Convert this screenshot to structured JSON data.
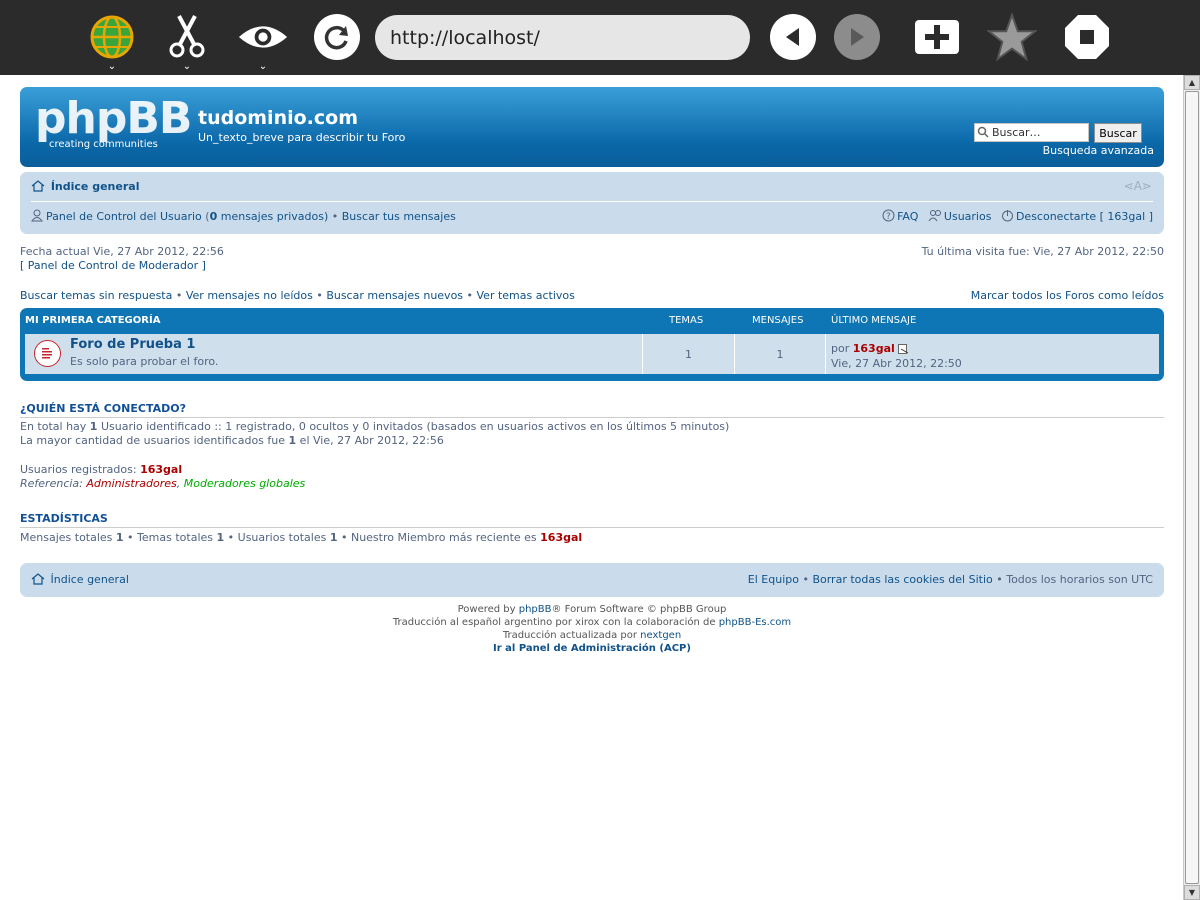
{
  "browser": {
    "url": "http://localhost/",
    "icons": [
      "globe-icon",
      "scissors-icon",
      "eye-icon",
      "reload-icon",
      "back-icon",
      "forward-icon",
      "add-bookmark-icon",
      "star-icon",
      "stop-icon"
    ],
    "caret": "⌄"
  },
  "header": {
    "logo_main": "phpBB",
    "logo_reg": "®",
    "logo_sub": "creating communities",
    "site_title": "tudominio.com",
    "site_desc": "Un_texto_breve para describir tu Foro",
    "search_placeholder": "Buscar…",
    "search_button": "Buscar",
    "advanced_search": "Busqueda avanzada"
  },
  "navbar": {
    "home": "Índice general",
    "font_resize": "⋖A⋗",
    "ucp_label": "Panel de Control del Usuario",
    "ucp_open": " (",
    "pm_count": "0",
    "pm_label": " mensajes privados)",
    "sep": " • ",
    "search_own": "Buscar tus mensajes",
    "faq": "FAQ",
    "members": "Usuarios",
    "logout": "Desconectarte [ 163gal ]"
  },
  "info": {
    "current_date": "Fecha actual Vie, 27 Abr 2012, 22:56",
    "mcp": "[ Panel de Control de Moderador ]",
    "last_visit": "Tu última visita fue: Vie, 27 Abr 2012, 22:50"
  },
  "quick_links": {
    "unanswered": "Buscar temas sin respuesta",
    "unread": "Ver mensajes no leídos",
    "new_posts": "Buscar mensajes nuevos",
    "active": "Ver temas activos",
    "sep": " • ",
    "mark_read": "Marcar todos los Foros como leídos"
  },
  "forum_table": {
    "category": "MI PRIMERA CATEGORÍA",
    "col_topics": "TEMAS",
    "col_posts": "MENSAJES",
    "col_last": "ÚLTIMO MENSAJE",
    "forum": {
      "title": "Foro de Prueba 1",
      "description": "Es solo para probar el foro.",
      "topics": "1",
      "posts": "1",
      "last_by_prefix": "por ",
      "last_by_user": "163gal",
      "last_date": "Vie, 27 Abr 2012, 22:50"
    }
  },
  "online": {
    "title": "¿QUIÉN ESTÁ CONECTADO?",
    "line1_prefix": "En total hay ",
    "line1_count": "1",
    "line1_rest": " Usuario identificado :: 1 registrado, 0 ocultos y 0 invitados (basados en usuarios activos en los últimos 5 minutos)",
    "line2_prefix": "La mayor cantidad de usuarios identificados fue ",
    "line2_count": "1",
    "line2_rest": " el Vie, 27 Abr 2012, 22:56",
    "registered_label": "Usuarios registrados: ",
    "registered_user": "163gal",
    "legend_label": "Referencia: ",
    "legend_admins": "Administradores",
    "legend_comma": ", ",
    "legend_globalmods": "Moderadores globales",
    "admin_color": "#aa0000",
    "globalmod_color": "#00aa00"
  },
  "stats": {
    "title": "ESTADÍSTICAS",
    "posts_label": "Mensajes totales ",
    "posts": "1",
    "topics_label": " • Temas totales ",
    "topics": "1",
    "users_label": " • Usuarios totales ",
    "users": "1",
    "newest_label": " • Nuestro Miembro más reciente es ",
    "newest_user": "163gal"
  },
  "footer": {
    "home": "Índice general",
    "team": "El Equipo",
    "sep": " • ",
    "delete_cookies": "Borrar todas las cookies del Sitio",
    "timezone": " • Todos los horarios son UTC",
    "powered_prefix": "Powered by ",
    "powered_link": "phpBB",
    "powered_rest": "® Forum Software © phpBB Group",
    "translation_prefix": "Traducción al español argentino por xirox con la colaboración de ",
    "translation_link": "phpBB-Es.com",
    "updated_prefix": "Traducción actualizada por ",
    "updated_link": "nextgen",
    "acp": "Ir al Panel de Administración (ACP)"
  }
}
